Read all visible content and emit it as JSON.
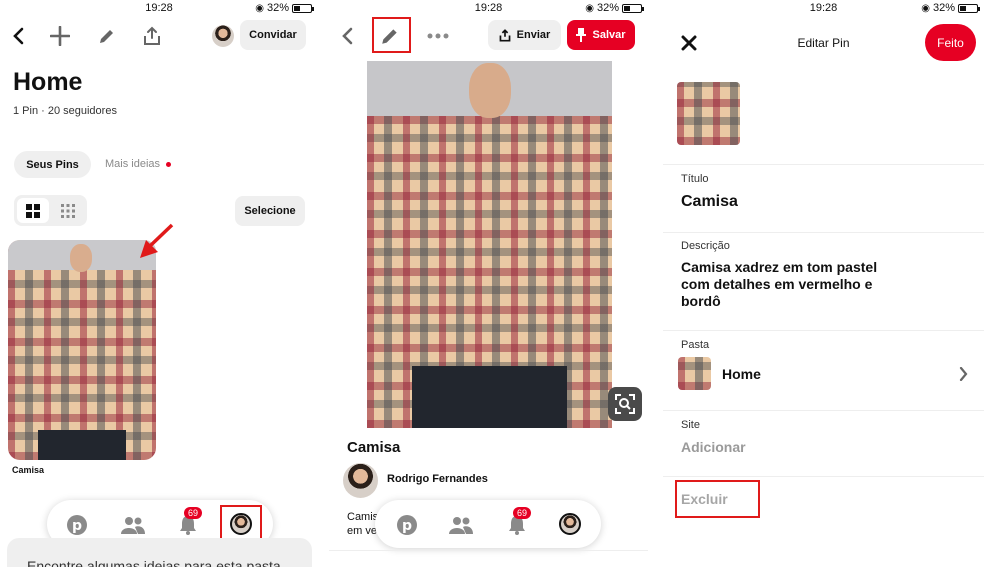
{
  "status": {
    "time": "19:28",
    "battery": "32%"
  },
  "board": {
    "title": "Home",
    "meta": "1 Pin · 20 seguidores",
    "invite_label": "Convidar",
    "tabs": [
      "Seus Pins",
      "Mais ideias"
    ],
    "select_label": "Selecione",
    "pin_caption": "Camisa",
    "nav_badge": "69",
    "bottom_text": "Encontre algumas ideias para esta pasta"
  },
  "pin": {
    "send_label": "Enviar",
    "save_label": "Salvar",
    "title": "Camisa",
    "author": "Rodrigo Fernandes",
    "desc_partial_1": "Camis",
    "desc_partial_2": "em ve",
    "nav_badge": "69"
  },
  "edit": {
    "header_title": "Editar Pin",
    "done_label": "Feito",
    "title_label": "Título",
    "title_value": "Camisa",
    "desc_label": "Descrição",
    "desc_value": "Camisa xadrez em tom pastel com detalhes em vermelho e bordô",
    "folder_label": "Pasta",
    "folder_value": "Home",
    "site_label": "Site",
    "site_placeholder": "Adicionar",
    "delete_label": "Excluir"
  },
  "colors": {
    "brand_red": "#e60023",
    "annotation_red": "#e01a1a",
    "pill_gray": "#efefef"
  },
  "icons": [
    "back-icon",
    "plus-icon",
    "pencil-icon",
    "share-icon",
    "grid-icon",
    "compact-grid-icon",
    "arrow-annotation-icon",
    "pinterest-logo-icon",
    "people-icon",
    "bell-icon",
    "ellipsis-icon",
    "pin-icon",
    "visual-search-icon",
    "close-icon",
    "chevron-right-icon"
  ]
}
